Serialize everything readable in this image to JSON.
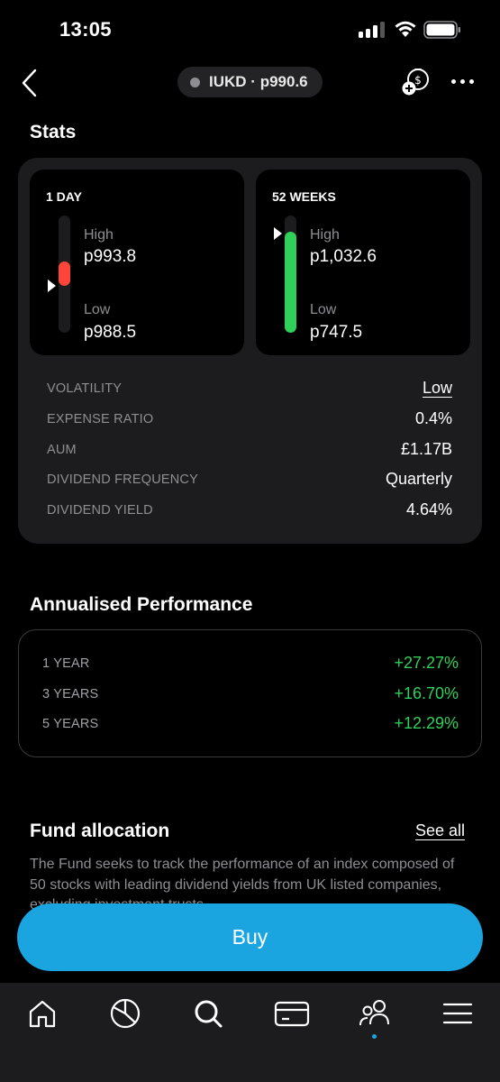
{
  "status_bar": {
    "time": "13:05"
  },
  "nav": {
    "ticker": "IUKD",
    "separator": "·",
    "price": "p990.6"
  },
  "stats": {
    "title": "Stats",
    "day": {
      "title": "1 DAY",
      "high_label": "High",
      "high_value": "p993.8",
      "low_label": "Low",
      "low_value": "p988.5"
    },
    "weeks": {
      "title": "52 WEEKS",
      "high_label": "High",
      "high_value": "p1,032.6",
      "low_label": "Low",
      "low_value": "p747.5"
    },
    "rows": [
      {
        "label": "VOLATILITY",
        "value": "Low"
      },
      {
        "label": "EXPENSE RATIO",
        "value": "0.4%"
      },
      {
        "label": "AUM",
        "value": "£1.17B"
      },
      {
        "label": "DIVIDEND FREQUENCY",
        "value": "Quarterly"
      },
      {
        "label": "DIVIDEND YIELD",
        "value": "4.64%"
      }
    ]
  },
  "performance": {
    "title": "Annualised Performance",
    "rows": [
      {
        "label": "1 YEAR",
        "value": "+27.27%"
      },
      {
        "label": "3 YEARS",
        "value": "+16.70%"
      },
      {
        "label": "5 YEARS",
        "value": "+12.29%"
      }
    ]
  },
  "fund_allocation": {
    "title": "Fund allocation",
    "see_all": "See all",
    "description": "The Fund seeks to track the performance of an index composed of 50 stocks with leading dividend yields from UK listed companies, excluding investment trusts."
  },
  "buy_button": {
    "label": "Buy"
  },
  "tab_bar": {
    "icons": [
      "home-icon",
      "portfolio-pie-icon",
      "search-icon",
      "card-icon",
      "community-icon",
      "menu-icon"
    ]
  },
  "colors": {
    "accent": "#1aa4e0",
    "positive": "#30d158",
    "negative": "#ff453a",
    "card": "#1c1c1e"
  }
}
